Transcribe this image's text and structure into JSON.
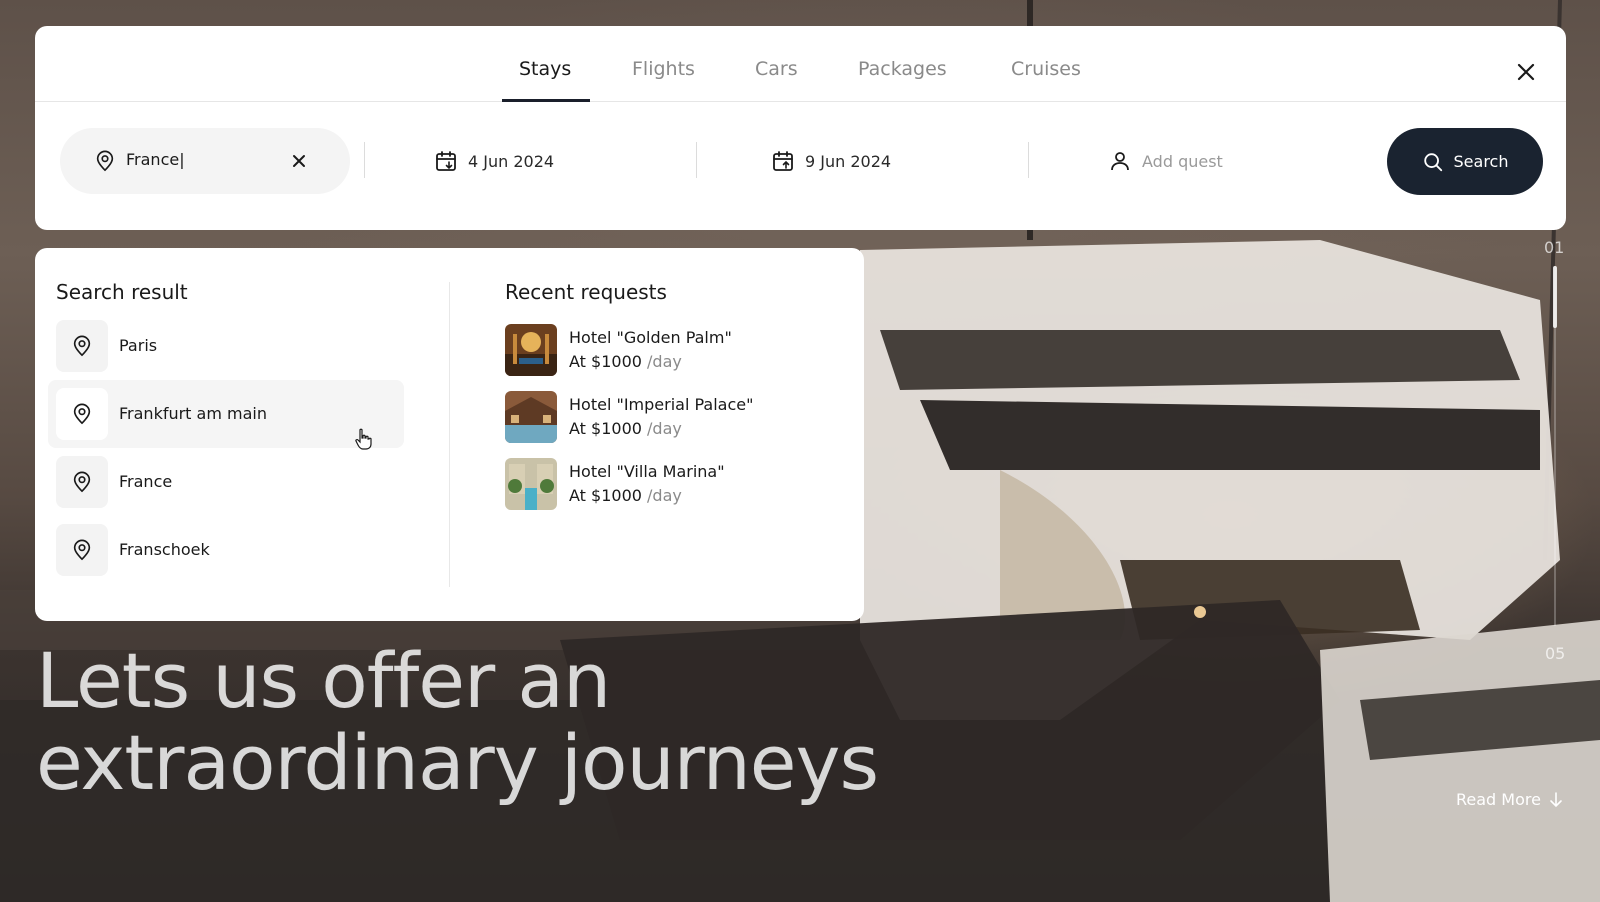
{
  "tabs": [
    {
      "label": "Stays",
      "active": true
    },
    {
      "label": "Flights",
      "active": false
    },
    {
      "label": "Cars",
      "active": false
    },
    {
      "label": "Packages",
      "active": false
    },
    {
      "label": "Cruises",
      "active": false
    }
  ],
  "search": {
    "destination_value": "France|",
    "check_in": "4 Jun 2024",
    "check_out": "9 Jun 2024",
    "guest_placeholder": "Add quest",
    "button_label": "Search"
  },
  "dropdown": {
    "results_title": "Search result",
    "results": [
      {
        "label": "Paris"
      },
      {
        "label": "Frankfurt am main"
      },
      {
        "label": "France"
      },
      {
        "label": "Franschoek"
      }
    ],
    "recent_title": "Recent requests",
    "recent": [
      {
        "name": "Hotel \"Golden Palm\"",
        "price": "At $1000",
        "unit": "/day"
      },
      {
        "name": "Hotel \"Imperial Palace\"",
        "price": "At $1000",
        "unit": "/day"
      },
      {
        "name": "Hotel \"Villa Marina\"",
        "price": "At $1000",
        "unit": "/day"
      }
    ]
  },
  "hero": {
    "line1": "Lets us offer an",
    "line2": "extraordinary journeys"
  },
  "slider": {
    "current": "01",
    "total": "05"
  },
  "read_more": "Read More",
  "colors": {
    "primary": "#1a2330",
    "panel": "#ffffff",
    "muted_text": "#8a8a8a"
  },
  "icons": {
    "close": "close-icon",
    "pin": "map-pin-icon",
    "calendar_in": "calendar-check-in-icon",
    "calendar_out": "calendar-check-out-icon",
    "user": "user-icon",
    "search": "search-icon",
    "arrow": "arrow-down-icon"
  }
}
